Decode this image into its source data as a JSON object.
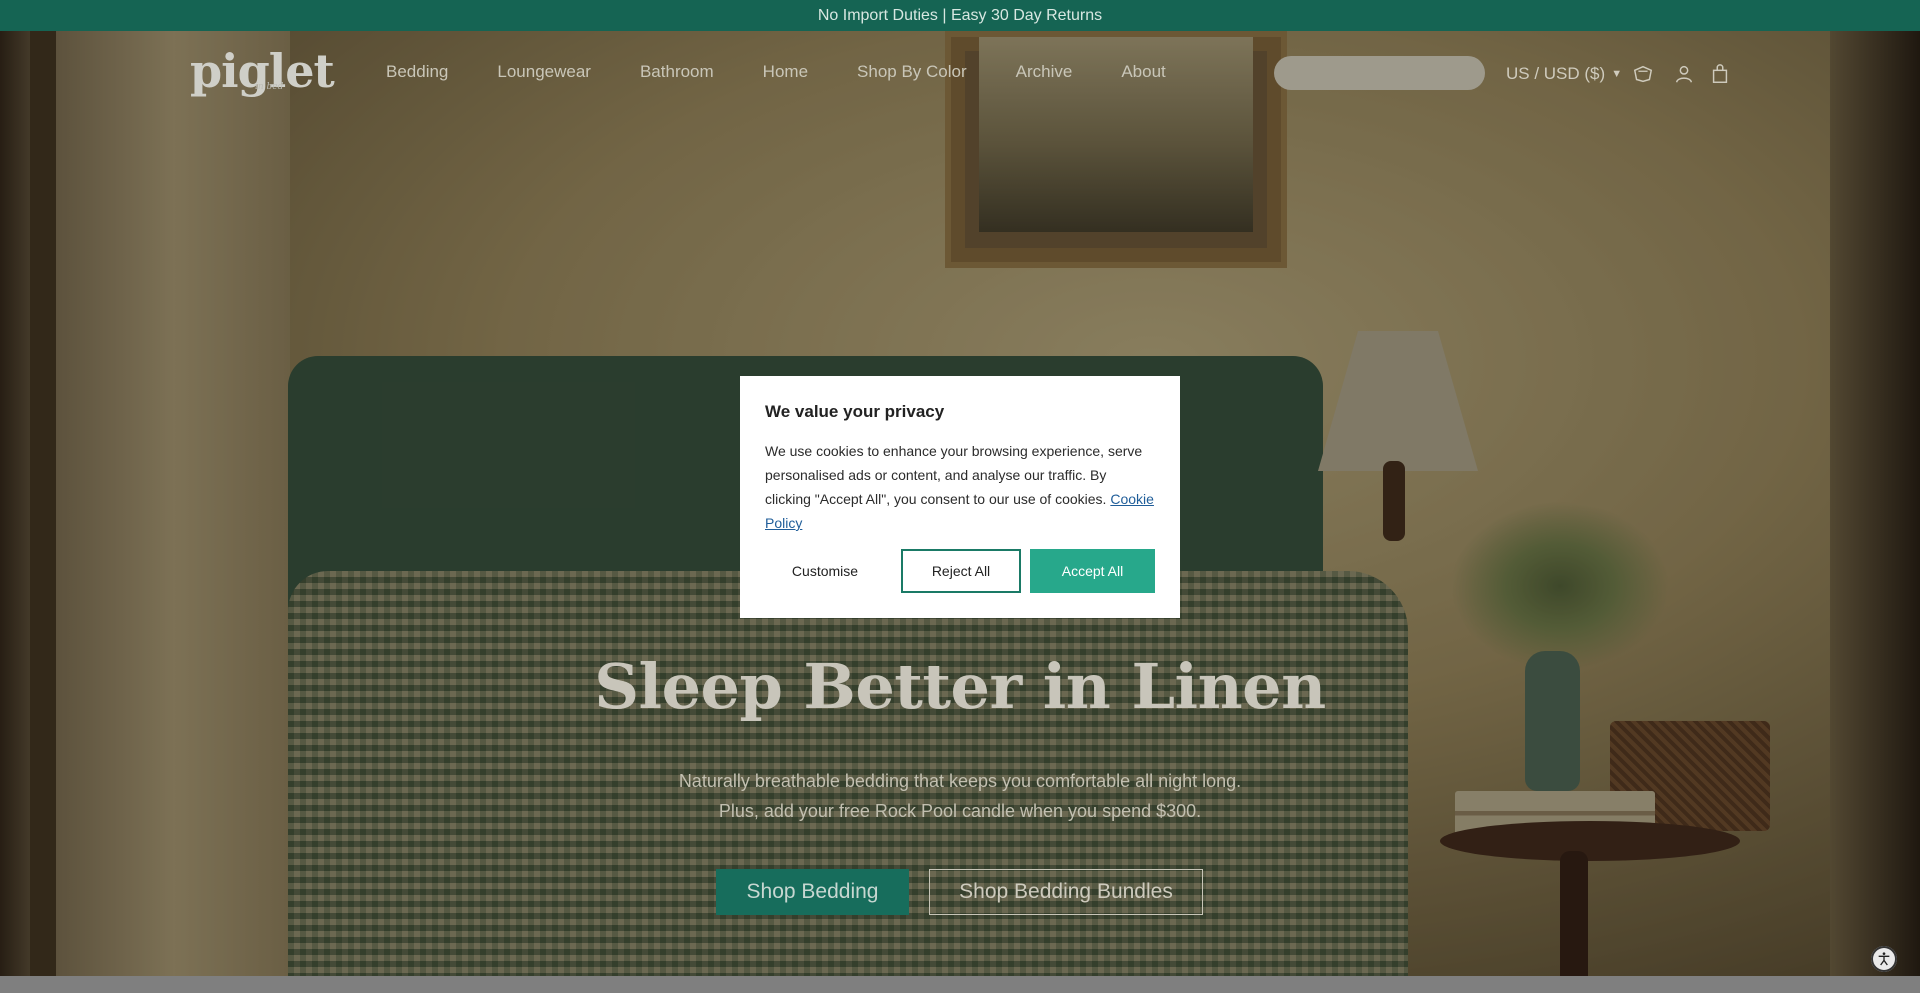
{
  "announcement": {
    "text": "No Import Duties | Easy 30 Day Returns"
  },
  "header": {
    "logo": "piglet",
    "logo_sub": "in bed",
    "nav": [
      "Bedding",
      "Loungewear",
      "Bathroom",
      "Home",
      "Shop By Color",
      "Archive",
      "About"
    ],
    "search": {
      "placeholder": "",
      "value": ""
    },
    "currency": "US / USD ($)",
    "icons": [
      "rewards-icon",
      "account-icon",
      "cart-icon"
    ]
  },
  "hero": {
    "title": "Sleep Better in Linen",
    "subtitle_line1": "Naturally breathable bedding that keeps you comfortable all night long.",
    "subtitle_line2": "Plus, add your free Rock Pool candle when you spend $300.",
    "primary_cta": "Shop Bedding",
    "secondary_cta": "Shop Bedding Bundles"
  },
  "privacy_modal": {
    "title": "We value your privacy",
    "body": "We use cookies to enhance your browsing experience, serve personalised ads or content, and analyse our traffic. By clicking \"Accept All\", you consent to our use of cookies.",
    "link": "Cookie Policy",
    "customise": "Customise",
    "reject": "Reject All",
    "accept": "Accept All"
  },
  "colors": {
    "brand_green": "#1a7a66",
    "accept_green": "#27a88b",
    "link_blue": "#1f5d99"
  }
}
